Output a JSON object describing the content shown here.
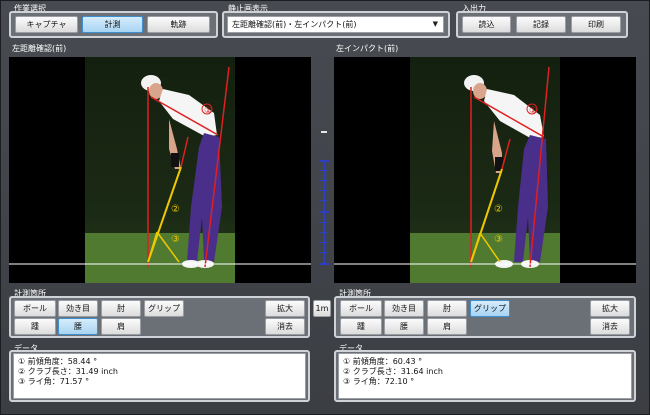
{
  "groups": {
    "work": "作業選択",
    "still": "静止画表示",
    "io": "入出力",
    "measure_left": "計測箇所",
    "measure_right": "計測箇所",
    "data_left": "データ",
    "data_right": "データ"
  },
  "work_buttons": [
    "キャプチャ",
    "計測",
    "軌跡"
  ],
  "still_select": "左距離確認(前)・左インパクト(前)",
  "io_buttons": [
    "読込",
    "記録",
    "印刷"
  ],
  "view_left_title": "左距離確認(前)",
  "view_right_title": "左インパクト(前)",
  "scale_label": "1m",
  "measure_buttons": {
    "row1": [
      "ボール",
      "効き目",
      "肘",
      "グリップ"
    ],
    "row2": [
      "踵",
      "腰",
      "肩"
    ],
    "zoom": "拡大",
    "erase": "消去"
  },
  "markers": [
    "①",
    "②",
    "③"
  ],
  "data_left": [
    "① 前傾角度：58.44 °",
    "② クラブ長さ：31.49 inch",
    "③ ライ角：71.57 °"
  ],
  "data_right": [
    "① 前傾角度：60.43 °",
    "② クラブ長さ：31.64 inch",
    "③ ライ角：72.10 °"
  ],
  "colors": {
    "accent_active": "#a8d4f2",
    "line_red": "#e02020",
    "line_yellow": "#f0c800",
    "scale_blue": "#2d3fbf"
  }
}
